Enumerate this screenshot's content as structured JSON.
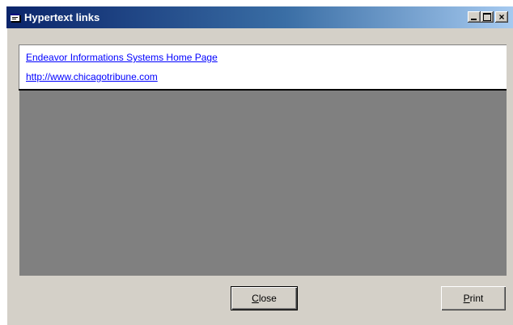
{
  "window": {
    "title": "Hypertext links",
    "title_icon": "app-window-icon",
    "controls": {
      "minimize_icon": "minimize-icon",
      "maximize_icon": "maximize-icon",
      "close_glyph": "×"
    }
  },
  "links": [
    {
      "text": "Endeavor Informations Systems Home Page"
    },
    {
      "text": "http://www.chicagotribune.com"
    }
  ],
  "buttons": {
    "close": {
      "mnemonic": "C",
      "rest": "lose"
    },
    "print": {
      "mnemonic": "P",
      "rest": "rint"
    }
  },
  "colors": {
    "titlebar_start": "#0a246a",
    "titlebar_end": "#a6caf0",
    "link": "#0000ff",
    "face": "#d4d0c8",
    "gray_area": "#808080"
  }
}
